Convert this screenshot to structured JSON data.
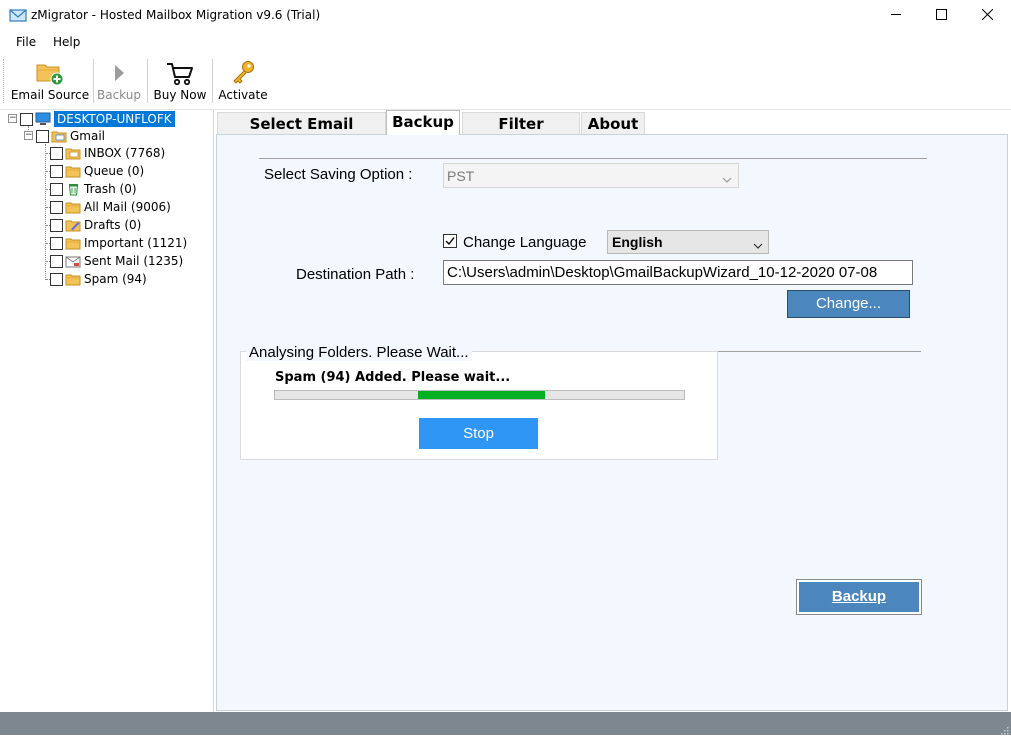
{
  "window": {
    "title": "zMigrator - Hosted Mailbox Migration v9.6 (Trial)",
    "icon": "mail-icon"
  },
  "menu": {
    "items": [
      "File",
      "Help"
    ]
  },
  "toolbar": {
    "email_source": "Email Source",
    "backup": "Backup",
    "buy_now": "Buy Now",
    "activate": "Activate"
  },
  "tree": {
    "root": "DESKTOP-UNFLOFK",
    "account": "Gmail",
    "folders": [
      {
        "label": "INBOX (7768)",
        "icon": "inbox-folder-icon"
      },
      {
        "label": "Queue (0)",
        "icon": "folder-icon"
      },
      {
        "label": "Trash (0)",
        "icon": "trash-icon"
      },
      {
        "label": "All Mail (9006)",
        "icon": "folder-icon"
      },
      {
        "label": "Drafts (0)",
        "icon": "drafts-folder-icon"
      },
      {
        "label": "Important (1121)",
        "icon": "folder-icon"
      },
      {
        "label": "Sent Mail (1235)",
        "icon": "sent-folder-icon"
      },
      {
        "label": "Spam (94)",
        "icon": "folder-icon"
      }
    ]
  },
  "tabs": [
    "Select Email Source",
    "Backup",
    "Filter Options",
    "About"
  ],
  "active_tab": "Backup",
  "backup": {
    "saving_option_label": "Select Saving Option :",
    "saving_option_value": "PST",
    "change_language_label": "Change Language",
    "change_language_checked": true,
    "language_value": "English",
    "destination_label": "Destination Path :",
    "destination_value": "C:\\Users\\admin\\Desktop\\GmailBackupWizard_10-12-2020 07-08",
    "change_button": "Change...",
    "progress_title": "Analysing Folders. Please Wait...",
    "progress_status": "Spam (94) Added. Please wait...",
    "progress_indeterminate_segment": [
      0.35,
      0.66
    ],
    "stop_button": "Stop",
    "backup_button": "Backup"
  },
  "colors": {
    "accent": "#4b86bd",
    "stop_button": "#2f96f5",
    "progress": "#06b025",
    "selection": "#0078d7",
    "content_bg": "#f2f8fd",
    "statusbar": "#7e868f"
  }
}
